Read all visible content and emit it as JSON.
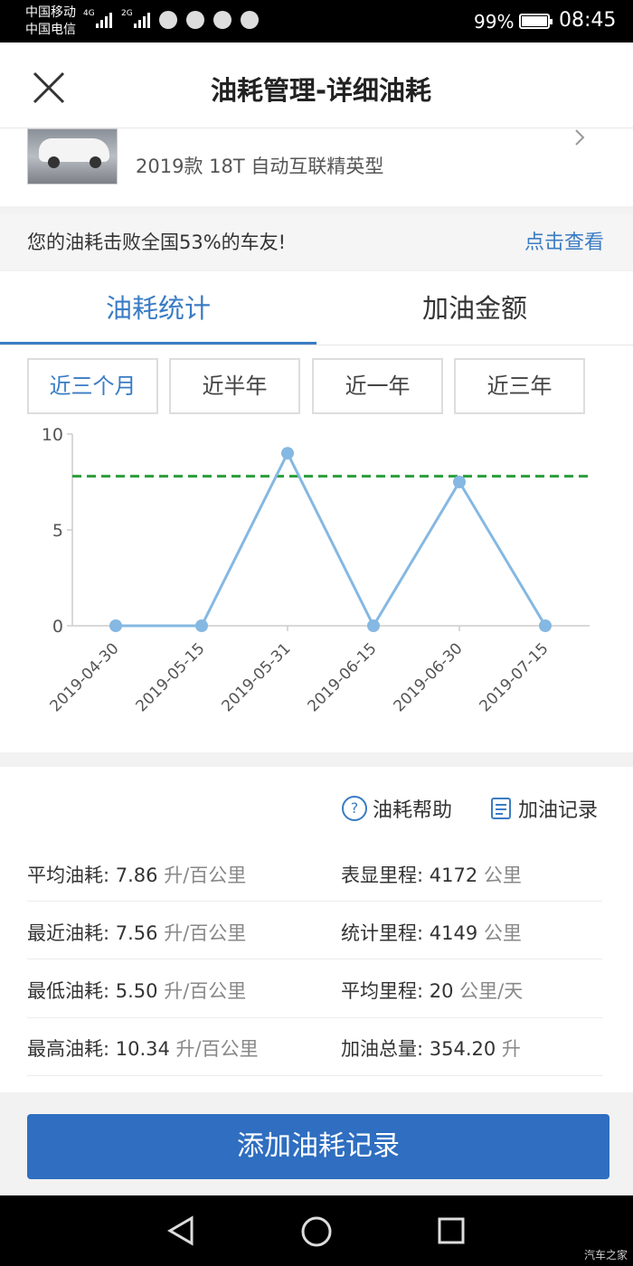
{
  "status_bar": {
    "carrier1": "中国移动",
    "carrier2": "中国电信",
    "signal1": "4G",
    "signal2": "2G",
    "battery_pct": "99%",
    "battery_level": 0.99,
    "time": "08:45"
  },
  "header": {
    "title": "油耗管理-详细油耗"
  },
  "car": {
    "model": "2019款 18T 自动互联精英型"
  },
  "beat": {
    "text": "您的油耗击败全国53%的车友!",
    "link": "点击查看"
  },
  "tabs": [
    {
      "label": "油耗统计"
    },
    {
      "label": "加油金额"
    }
  ],
  "ranges": [
    {
      "label": "近三个月"
    },
    {
      "label": "近半年"
    },
    {
      "label": "近一年"
    },
    {
      "label": "近三年"
    }
  ],
  "chart_data": {
    "type": "line",
    "x": [
      "2019-04-30",
      "2019-05-15",
      "2019-05-31",
      "2019-06-15",
      "2019-06-30",
      "2019-07-15"
    ],
    "values": [
      0,
      0,
      9,
      0,
      7.5,
      0
    ],
    "average_line": 7.8,
    "ylim": [
      0,
      10
    ],
    "yticks": [
      "10",
      "5",
      "0"
    ],
    "colors": {
      "line": "#85b8e2",
      "average": "#2a9d3a",
      "axis": "#cccccc"
    }
  },
  "links": {
    "help": "油耗帮助",
    "help_icon": "?",
    "log": "加油记录"
  },
  "stats": {
    "avg_label": "平均油耗: 7.86",
    "avg_unit": " 升/百公里",
    "odo_label": "表显里程: 4172",
    "odo_unit": " 公里",
    "recent_label": "最近油耗: 7.56",
    "recent_unit": " 升/百公里",
    "calc_label": "统计里程: 4149",
    "calc_unit": " 公里",
    "min_label": "最低油耗: 5.50",
    "min_unit": " 升/百公里",
    "daily_label": "平均里程: 20",
    "daily_unit": " 公里/天",
    "max_label": "最高油耗: 10.34",
    "max_unit": " 升/百公里",
    "fuel_label": "加油总量: 354.20",
    "fuel_unit": " 升"
  },
  "add_button": "添加油耗记录",
  "watermark": "汽车之家"
}
